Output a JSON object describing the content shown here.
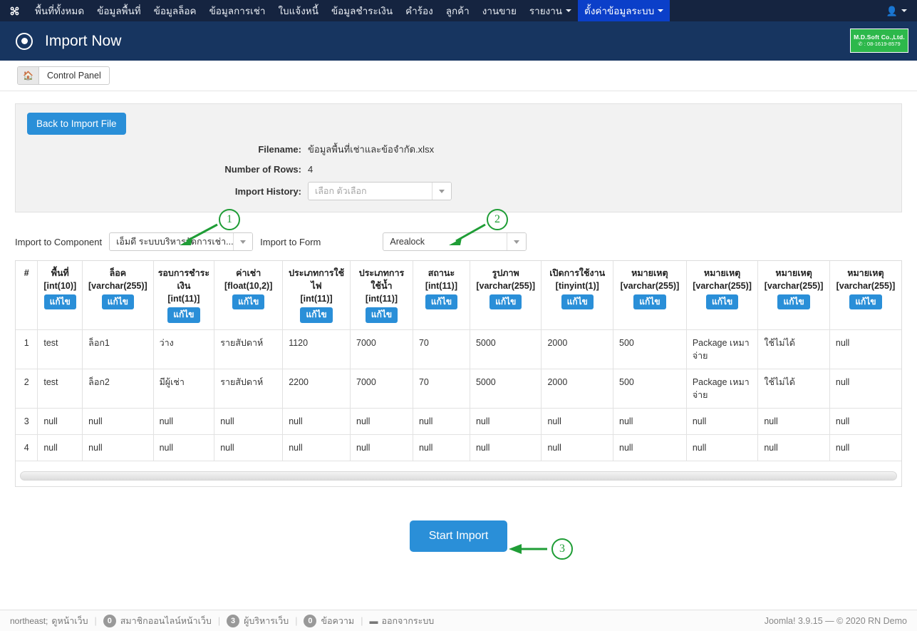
{
  "navbar": {
    "logo_icon": "joomla-icon",
    "items": [
      {
        "label": "พื้นที่ทั้งหมด",
        "active": false,
        "caret": false
      },
      {
        "label": "ข้อมูลพื้นที่",
        "active": false,
        "caret": false
      },
      {
        "label": "ข้อมูลล็อค",
        "active": false,
        "caret": false
      },
      {
        "label": "ข้อมูลการเช่า",
        "active": false,
        "caret": false
      },
      {
        "label": "ใบแจ้งหนี้",
        "active": false,
        "caret": false
      },
      {
        "label": "ข้อมูลชำระเงิน",
        "active": false,
        "caret": false
      },
      {
        "label": "คำร้อง",
        "active": false,
        "caret": false
      },
      {
        "label": "ลูกค้า",
        "active": false,
        "caret": false
      },
      {
        "label": "งานขาย",
        "active": false,
        "caret": false
      },
      {
        "label": "รายงาน",
        "active": false,
        "caret": true
      },
      {
        "label": "ตั้งค่าข้อมูลระบบ",
        "active": true,
        "caret": true
      }
    ],
    "user_icon": "user-icon"
  },
  "header": {
    "title": "Import Now",
    "icon": "target-circle-icon",
    "brand": {
      "line1": "M.D.Soft Co.,Ltd.",
      "line2": "✆ : 08-1619-8579"
    }
  },
  "breadcrumb": {
    "home_icon": "home-icon",
    "label": "Control Panel"
  },
  "panel": {
    "back_button": "Back to Import File",
    "filename_label": "Filename:",
    "filename_value": "ข้อมูลพื้นที่เช่าและข้อจำกัด.xlsx",
    "rows_label": "Number of Rows:",
    "rows_value": "4",
    "history_label": "Import History:",
    "history_placeholder": "เลือก ตัวเลือก"
  },
  "mapping": {
    "component_label": "Import to Component",
    "component_value": "เอ็มดี ระบบบริหารจัดการเช่า...",
    "form_label": "Import to Form",
    "form_value": "Arealock"
  },
  "table": {
    "index_header": "#",
    "edit_label": "แก้ไข",
    "columns": [
      {
        "name": "พื้นที่",
        "type": "[int(10)]"
      },
      {
        "name": "ล็อค",
        "type": "[varchar(255)]"
      },
      {
        "name": "รอบการชำระเงิน",
        "type": "[int(11)]"
      },
      {
        "name": "ค่าเช่า",
        "type": "[float(10,2)]"
      },
      {
        "name": "ประเภทการใช้ไฟ",
        "type": "[int(11)]"
      },
      {
        "name": "ประเภทการใช้น้ำ",
        "type": "[int(11)]"
      },
      {
        "name": "สถานะ",
        "type": "[int(11)]"
      },
      {
        "name": "รูปภาพ",
        "type": "[varchar(255)]"
      },
      {
        "name": "เปิดการใช้งาน",
        "type": "[tinyint(1)]"
      },
      {
        "name": "หมายเหตุ",
        "type": "[varchar(255)]"
      },
      {
        "name": "หมายเหตุ",
        "type": "[varchar(255)]"
      },
      {
        "name": "หมายเหตุ",
        "type": "[varchar(255)]"
      },
      {
        "name": "หมายเหตุ",
        "type": "[varchar(255)]"
      }
    ],
    "rows": [
      {
        "n": "1",
        "cells": [
          "test",
          "ล็อก1",
          "ว่าง",
          "รายสัปดาห์",
          "1120",
          "7000",
          "70",
          "5000",
          "2000",
          "500",
          "Package เหมาจ่าย",
          "ใช้ไม่ได้",
          "null"
        ]
      },
      {
        "n": "2",
        "cells": [
          "test",
          "ล็อก2",
          "มีผู้เช่า",
          "รายสัปดาห์",
          "2200",
          "7000",
          "70",
          "5000",
          "2000",
          "500",
          "Package เหมาจ่าย",
          "ใช้ไม่ได้",
          "null"
        ]
      },
      {
        "n": "3",
        "cells": [
          "null",
          "null",
          "null",
          "null",
          "null",
          "null",
          "null",
          "null",
          "null",
          "null",
          "null",
          "null",
          "null"
        ]
      },
      {
        "n": "4",
        "cells": [
          "null",
          "null",
          "null",
          "null",
          "null",
          "null",
          "null",
          "null",
          "null",
          "null",
          "null",
          "null",
          "null"
        ]
      }
    ]
  },
  "actions": {
    "start_import": "Start Import"
  },
  "annotations": [
    {
      "number": "1"
    },
    {
      "number": "2"
    },
    {
      "number": "3"
    }
  ],
  "annotation_color": "#1f9d36",
  "statusbar": {
    "view_site": "ดูหน้าเว็บ",
    "visitors_count": "0",
    "visitors_label": "สมาชิกออนไลน์หน้าเว็บ",
    "admins_count": "3",
    "admins_label": "ผู้บริหารเว็บ",
    "messages_count": "0",
    "messages_label": "ข้อความ",
    "logout": "ออกจากระบบ",
    "copyright": "Joomla! 3.9.15  —  © 2020 RN Demo"
  },
  "colors": {
    "navbar": "#152440",
    "active": "#0b3fc9",
    "header": "#173560",
    "primary": "#2a8fd8",
    "accent_green": "#2db84b"
  }
}
